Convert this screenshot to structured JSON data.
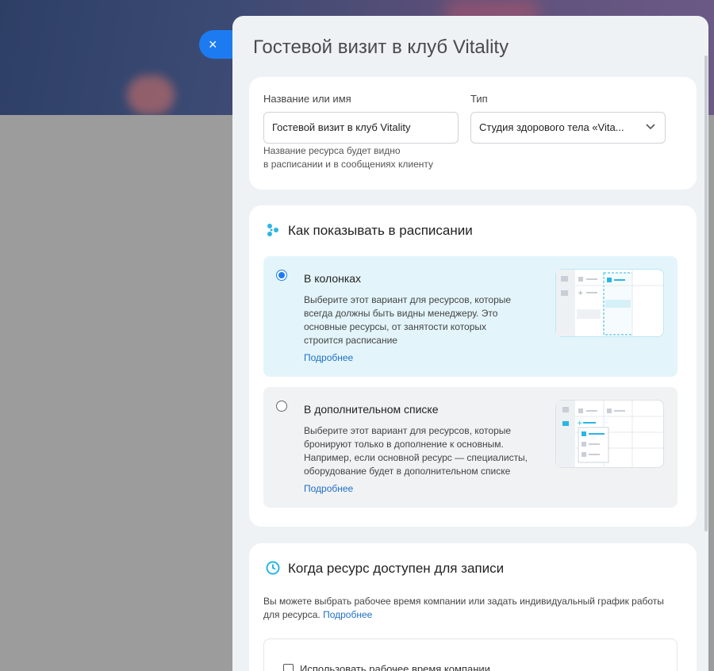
{
  "panel": {
    "title": "Гостевой визит в клуб Vitality",
    "close_label": "×"
  },
  "basic": {
    "name_label": "Название или имя",
    "name_value": "Гостевой визит в клуб Vitality",
    "name_hint_line1": "Название ресурса будет видно",
    "name_hint_line2": "в расписании и в сообщениях клиенту",
    "type_label": "Тип",
    "type_value": "Студия здорового тела «Vita..."
  },
  "schedule_display": {
    "title": "Как показывать в расписании",
    "options": [
      {
        "title": "В колонках",
        "selected": true,
        "desc_lines": [
          "Выберите этот вариант для ресурсов, которые",
          "всегда должны быть видны менеджеру. Это",
          "основные ресурсы, от занятости которых",
          "строится расписание"
        ],
        "link": "Подробнее"
      },
      {
        "title": "В дополнительном списке",
        "selected": false,
        "desc_lines": [
          "Выберите этот вариант для ресурсов, которые",
          "бронируют только в дополнение к основным.",
          "Например, если основной ресурс — специалисты,",
          "оборудование будет в дополнительном списке"
        ],
        "link": "Подробнее"
      }
    ]
  },
  "availability": {
    "title": "Когда ресурс доступен для записи",
    "text": "Вы можете выбрать рабочее время компании или задать индивидуальный график работы для ресурса.",
    "link": "Подробнее",
    "checkbox_label": "Использовать рабочее время компании"
  },
  "colors": {
    "accent": "#1d7bf2",
    "link": "#1f6fc9",
    "selected_bg": "#e3f5fb"
  }
}
